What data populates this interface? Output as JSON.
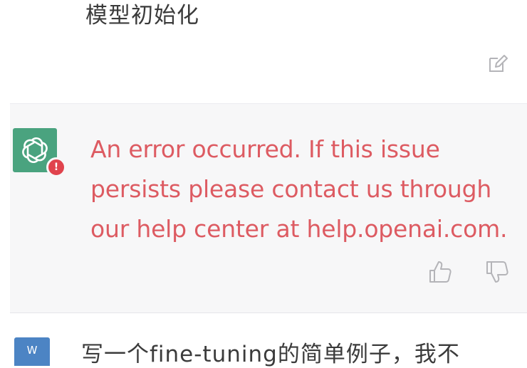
{
  "conversation": {
    "top_user_message": "模型初始化",
    "assistant_error": {
      "text": "An error occurred. If this issue persists please contact us through our help center at help.openai.com.",
      "status_color": "#e0434d",
      "text_color": "#dd5b62"
    },
    "bottom_user_message": "写一个fine-tuning的简单例子，我不",
    "bottom_user_avatar": "W"
  },
  "icons": {
    "edit": "edit-icon",
    "assistant_logo": "openai-logo-icon",
    "error_badge": "error-badge-icon",
    "thumbs_up": "thumbs-up-icon",
    "thumbs_down": "thumbs-down-icon"
  },
  "colors": {
    "assistant_avatar_bg": "#4aa37f",
    "assistant_row_bg": "#f7f7f8",
    "user_avatar_bg": "#4c84c4"
  }
}
